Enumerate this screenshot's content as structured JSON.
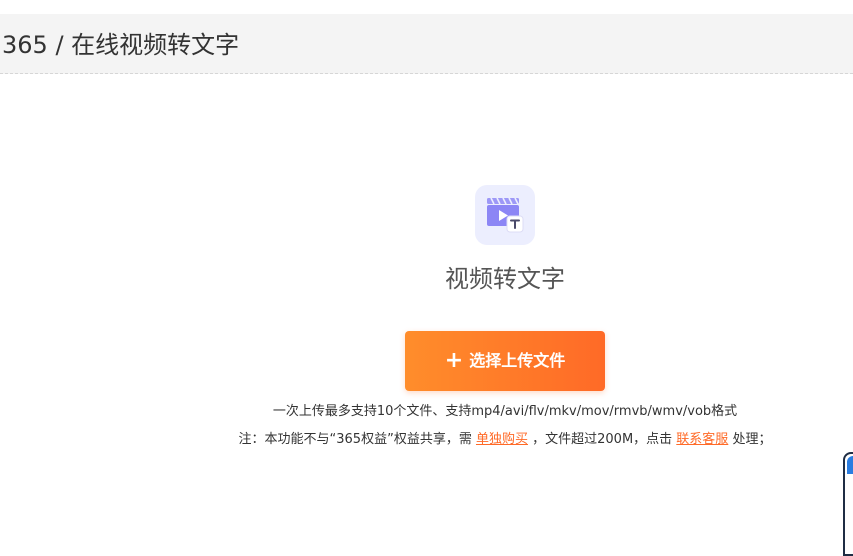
{
  "header": {
    "title": "365 / 在线视频转文字"
  },
  "tool": {
    "icon": "video-to-text-icon",
    "name": "视频转文字"
  },
  "upload": {
    "plus_glyph": "+",
    "label": "选择上传文件"
  },
  "hints": {
    "line1": "一次上传最多支持10个文件、支持mp4/avi/flv/mkv/mov/rmvb/wmv/vob格式",
    "line2_prefix": "注：本功能不与“365权益”权益共享，需",
    "buy_link": "单独购买",
    "line2_middle": "，文件超过200M，点击",
    "support_link": "联系客服",
    "line2_suffix": "处理；"
  },
  "colors": {
    "accent": "#ff6a27",
    "header_bg": "#f4f4f4",
    "icon_bg": "#eceefe",
    "icon_purple": "#8c86f5"
  }
}
